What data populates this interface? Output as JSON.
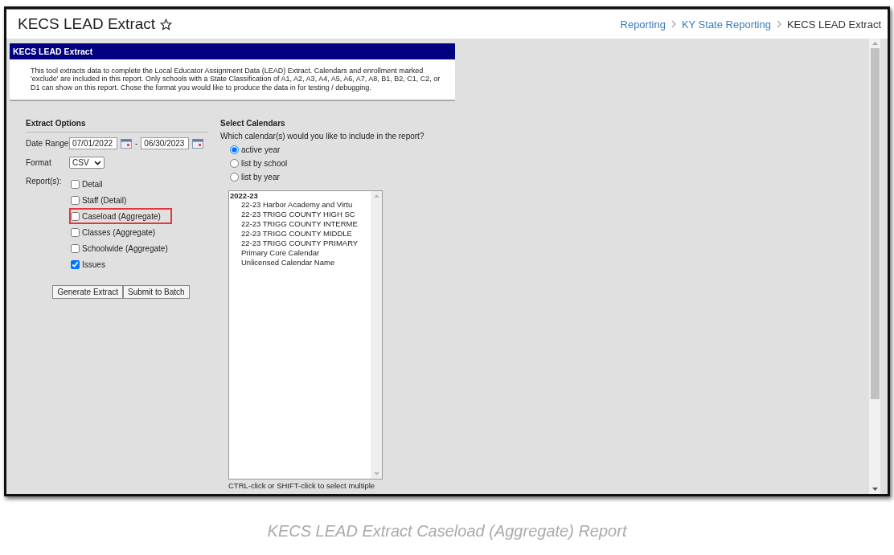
{
  "page_header": {
    "title": "KECS LEAD Extract",
    "breadcrumbs": [
      {
        "label": "Reporting",
        "link": true
      },
      {
        "label": "KY State Reporting",
        "link": true
      },
      {
        "label": "KECS LEAD Extract",
        "link": false
      }
    ]
  },
  "panel": {
    "title": "KECS LEAD Extract",
    "description": "This tool extracts data to complete the Local Educator Assignment Data (LEAD) Extract. Calendars and enrollment marked 'exclude' are included in this report. Only schools with a State Classification of A1, A2, A3, A4, A5, A6, A7, A8, B1, B2, C1, C2, or D1 can show on this report. Chose the format you would like to produce the data in for testing / debugging."
  },
  "extract_options": {
    "heading": "Extract Options",
    "date_range": {
      "label": "Date Range",
      "start": "07/01/2022",
      "separator": "-",
      "end": "06/30/2023"
    },
    "format": {
      "label": "Format",
      "value": "CSV"
    },
    "reports": {
      "label": "Report(s):",
      "items": [
        {
          "label": "Detail",
          "checked": false,
          "highlighted": false
        },
        {
          "label": "Staff (Detail)",
          "checked": false,
          "highlighted": false
        },
        {
          "label": "Caseload (Aggregate)",
          "checked": false,
          "highlighted": true
        },
        {
          "label": "Classes (Aggregate)",
          "checked": false,
          "highlighted": false
        },
        {
          "label": "Schoolwide (Aggregate)",
          "checked": false,
          "highlighted": false
        },
        {
          "label": "Issues",
          "checked": true,
          "highlighted": false
        }
      ]
    },
    "buttons": [
      "Generate Extract",
      "Submit to Batch"
    ]
  },
  "select_calendars": {
    "heading": "Select Calendars",
    "question": "Which calendar(s) would you like to include in the report?",
    "options": [
      {
        "label": "active year",
        "selected": true
      },
      {
        "label": "list by school",
        "selected": false
      },
      {
        "label": "list by year",
        "selected": false
      }
    ],
    "calendar_list": [
      {
        "label": "2022-23",
        "children": [
          {
            "label": "22-23 Harbor Academy and Virtu"
          },
          {
            "label": "22-23 TRIGG COUNTY HIGH SC"
          },
          {
            "label": "22-23 TRIGG COUNTY INTERME"
          },
          {
            "label": "22-23 TRIGG COUNTY MIDDLE"
          },
          {
            "label": "22-23 TRIGG COUNTY PRIMARY"
          },
          {
            "label": "Primary Core Calendar"
          },
          {
            "label": "Unlicensed Calendar Name"
          }
        ]
      }
    ],
    "hint": "CTRL-click or SHIFT-click to select multiple"
  },
  "caption": "KECS LEAD Extract Caseload (Aggregate) Report"
}
